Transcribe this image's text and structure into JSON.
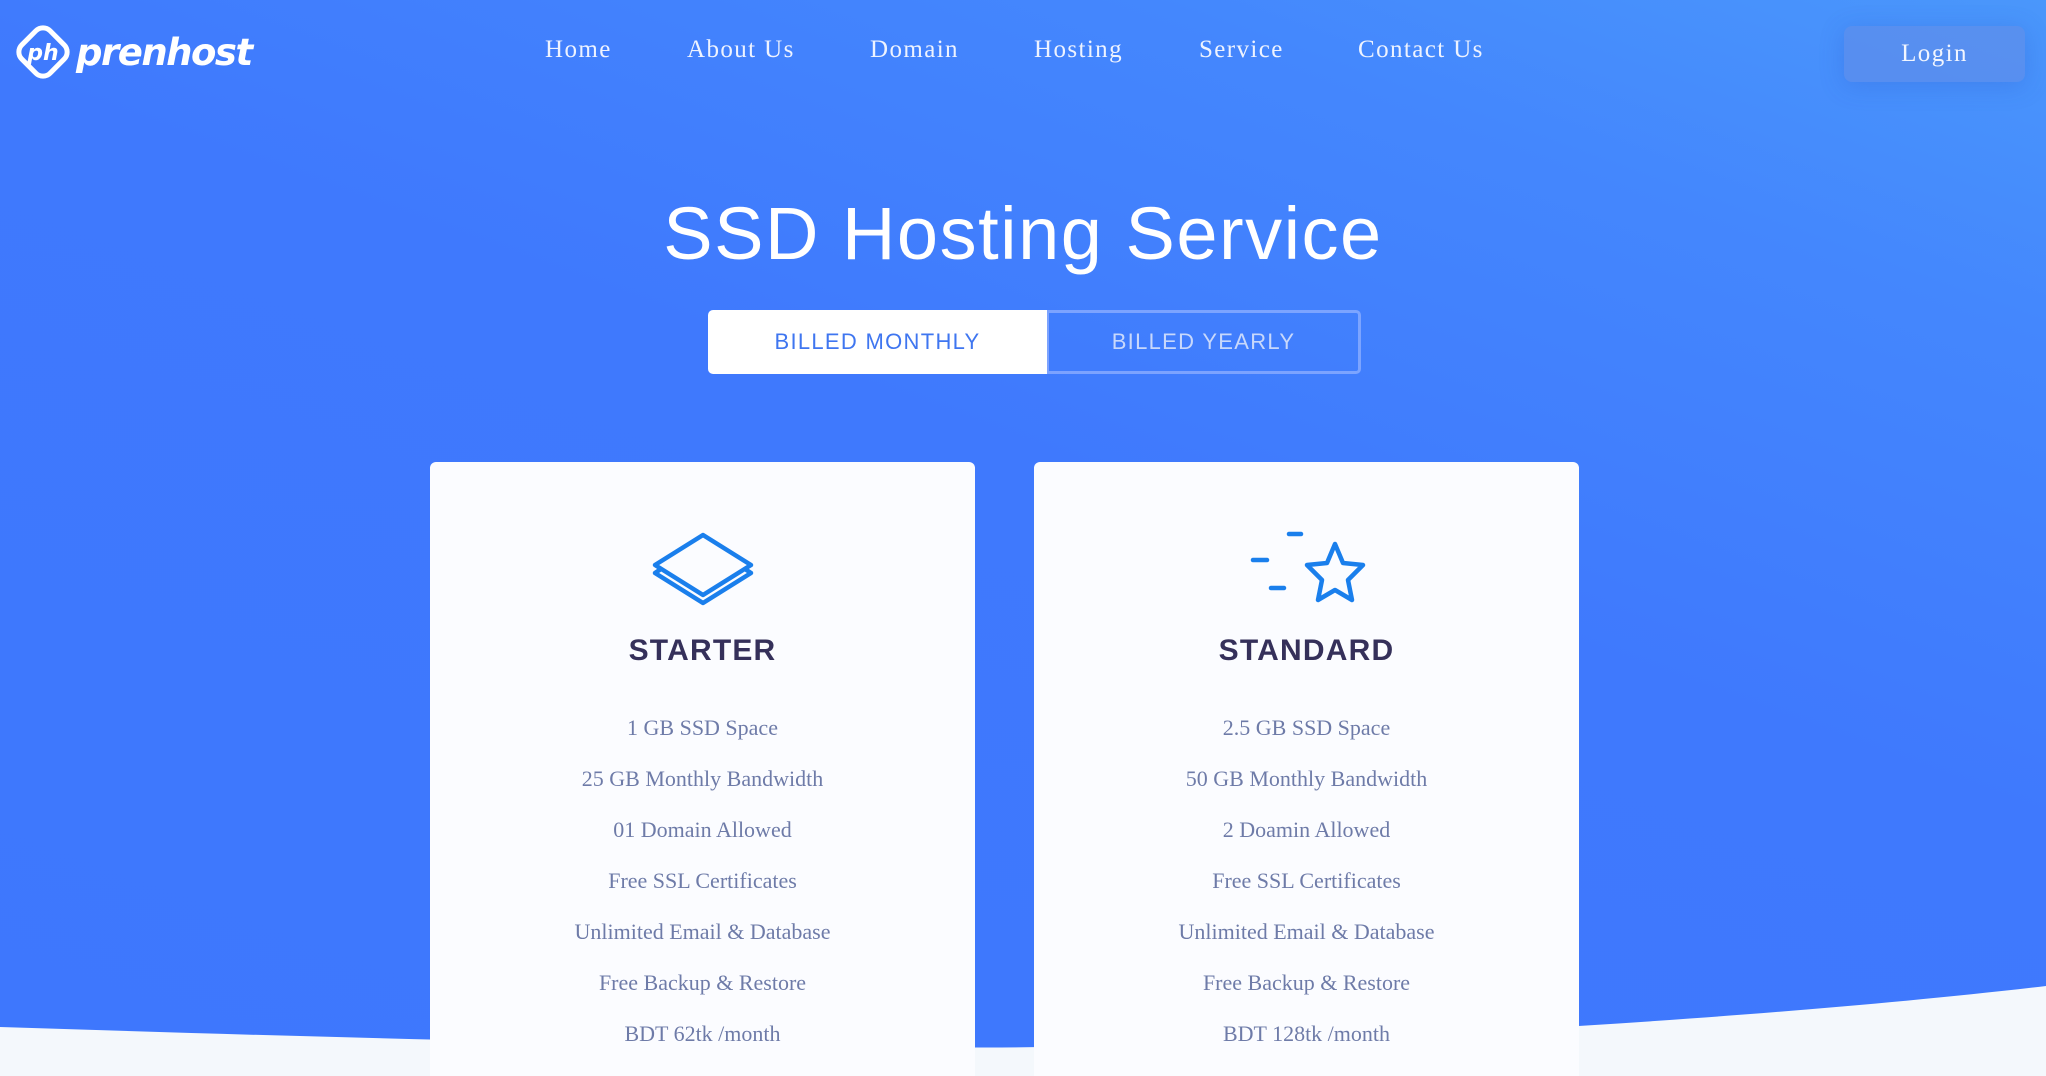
{
  "brand": {
    "name": "prenhost",
    "logo_monogram": "ph",
    "logo_icon": "brand-logo-icon"
  },
  "colors": {
    "primary_blue": "#3f78fd",
    "gradient_light": "#4a97fb",
    "card_bg": "#fbfcff",
    "plan_title": "#35305a",
    "feature_text": "#6e7ba8",
    "icon_blue": "#1a7fec",
    "footer_bg": "#f4f8fc"
  },
  "nav": {
    "items": [
      {
        "label": "Home"
      },
      {
        "label": "About Us"
      },
      {
        "label": "Domain"
      },
      {
        "label": "Hosting"
      },
      {
        "label": "Service"
      },
      {
        "label": "Contact Us"
      }
    ],
    "login_label": "Login"
  },
  "hero": {
    "title": "SSD Hosting Service",
    "billing": {
      "monthly_label": "BILLED MONTHLY",
      "yearly_label": "BILLED YEARLY",
      "selected": "monthly"
    }
  },
  "plans": [
    {
      "name": "STARTER",
      "icon": "layers-icon",
      "features": [
        "1 GB SSD Space",
        "25 GB Monthly Bandwidth",
        "01 Domain Allowed",
        "Free SSL Certificates",
        "Unlimited Email & Database",
        "Free Backup & Restore",
        "BDT 62tk /month"
      ]
    },
    {
      "name": "STANDARD",
      "icon": "star-icon",
      "features": [
        "2.5 GB SSD Space",
        "50 GB Monthly Bandwidth",
        "2 Doamin Allowed",
        "Free SSL Certificates",
        "Unlimited Email & Database",
        "Free Backup & Restore",
        "BDT 128tk /month"
      ]
    }
  ]
}
